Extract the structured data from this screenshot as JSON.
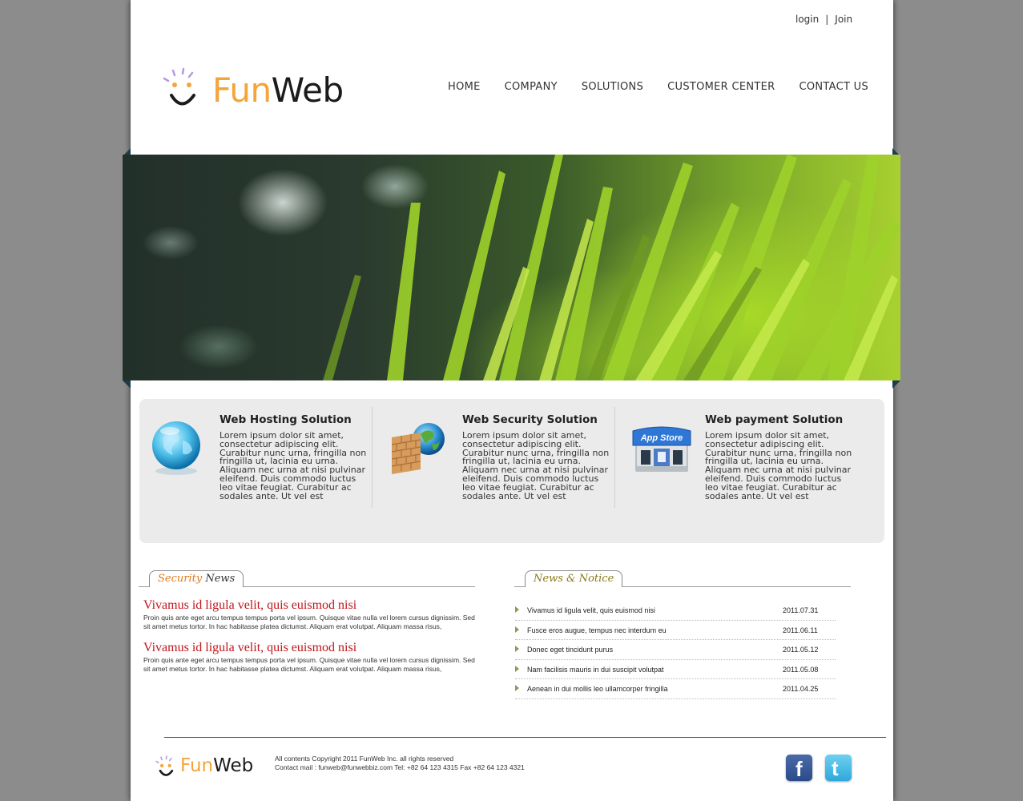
{
  "header": {
    "login_label": "login",
    "separator": "|",
    "join_label": "Join",
    "logo": {
      "fun": "Fun",
      "web": "Web"
    }
  },
  "nav": {
    "items": [
      {
        "label": "HOME"
      },
      {
        "label": "COMPANY"
      },
      {
        "label": "SOLUTIONS"
      },
      {
        "label": "CUSTOMER CENTER"
      },
      {
        "label": "CONTACT US"
      }
    ]
  },
  "solutions": [
    {
      "title": "Web Hosting Solution",
      "text": "Lorem ipsum dolor sit amet, consectetur adipiscing elit. Curabitur nunc urna, fringilla non fringilla ut, lacinia eu urna. Aliquam nec urna at nisi pulvinar eleifend. Duis commodo luctus leo vitae feugiat. Curabitur ac sodales ante. Ut vel est",
      "icon": "globe-icon"
    },
    {
      "title": "Web Security Solution",
      "text": "Lorem ipsum dolor sit amet, consectetur adipiscing elit. Curabitur nunc urna, fringilla non fringilla ut, lacinia eu urna. Aliquam nec urna at nisi pulvinar eleifend. Duis commodo luctus leo vitae feugiat. Curabitur ac sodales ante. Ut vel est",
      "icon": "firewall-icon"
    },
    {
      "title": "Web payment Solution",
      "text": "Lorem ipsum dolor sit amet, consectetur adipiscing elit. Curabitur nunc urna, fringilla non fringilla ut, lacinia eu urna. Aliquam nec urna at nisi pulvinar eleifend. Duis commodo luctus leo vitae feugiat. Curabitur ac sodales ante. Ut vel est",
      "icon": "app-store-icon",
      "icon_label": "App Store"
    }
  ],
  "security_news": {
    "tab_part1": "Security",
    "tab_part2": "News",
    "articles": [
      {
        "title": "Vivamus id ligula velit, quis euismod nisi",
        "body": "Proin quis ante eget arcu tempus tempus porta vel ipsum. Quisque vitae nulla vel lorem cursus dignissim. Sed sit amet metus tortor. In hac habitasse platea dictumst. Aliquam erat volutpat. Aliquam massa risus,"
      },
      {
        "title": "Vivamus id ligula velit, quis euismod nisi",
        "body": "Proin quis ante eget arcu tempus tempus porta vel ipsum. Quisque vitae nulla vel lorem cursus dignissim. Sed sit amet metus tortor. In hac habitasse platea dictumst. Aliquam erat volutpat. Aliquam massa risus,"
      }
    ]
  },
  "news_notice": {
    "tab": "News & Notice",
    "items": [
      {
        "title": "Vivamus id ligula velit, quis euismod nisi",
        "date": "2011.07.31"
      },
      {
        "title": "Fusce eros augue, tempus nec interdum eu",
        "date": "2011.06.11"
      },
      {
        "title": "Donec eget tincidunt purus",
        "date": "2011.05.12"
      },
      {
        "title": "Nam facilisis mauris in dui suscipit volutpat",
        "date": "2011.05.08"
      },
      {
        "title": "Aenean in dui mollis leo ullamcorper fringilla",
        "date": "2011.04.25"
      }
    ]
  },
  "footer": {
    "logo": {
      "fun": "Fun",
      "web": "Web"
    },
    "copyright": "All contents Copyright 2011 FunWeb Inc. all rights reserved",
    "contact": "Contact mail : funweb@funwebbiz.com Tel: +82 64 123 4315 Fax +82 64 123 4321",
    "facebook_glyph": "f",
    "twitter_glyph": "t"
  },
  "colors": {
    "logo_orange": "#f3a53c",
    "news_title_red": "#c0141b",
    "background_gray": "#8c8c8c"
  }
}
